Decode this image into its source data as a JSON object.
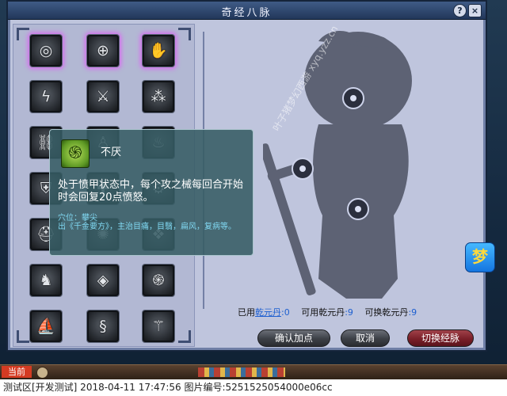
{
  "window": {
    "title": "奇经八脉",
    "help_label": "?",
    "close_label": "×"
  },
  "skills": [
    {
      "icon": "eye-rune-icon",
      "glyph": "◎",
      "active": true
    },
    {
      "icon": "magnifier-rune-icon",
      "glyph": "⊕",
      "active": true
    },
    {
      "icon": "palm-rune-icon",
      "glyph": "✋",
      "active": true
    },
    {
      "icon": "lightning-rune-icon",
      "glyph": "ϟ"
    },
    {
      "icon": "swords-rune-icon",
      "glyph": "⚔"
    },
    {
      "icon": "orbs-rune-icon",
      "glyph": "⁂"
    },
    {
      "icon": "chain-rune-icon",
      "glyph": "⛓"
    },
    {
      "icon": "figure-rune-icon",
      "glyph": "♙"
    },
    {
      "icon": "flame-rune-icon",
      "glyph": "♨"
    },
    {
      "icon": "shield-rune-icon",
      "glyph": "⛨"
    },
    {
      "icon": "cross-rune-icon",
      "glyph": "✚"
    },
    {
      "icon": "gear-rune-icon",
      "glyph": "⚙"
    },
    {
      "icon": "helmet-rune-icon",
      "glyph": "⛑"
    },
    {
      "icon": "spiral-rune-icon",
      "glyph": "✺"
    },
    {
      "icon": "shield-mark-rune-icon",
      "glyph": "❖"
    },
    {
      "icon": "warrior-rune-icon",
      "glyph": "♞"
    },
    {
      "icon": "gem-rune-icon",
      "glyph": "◈"
    },
    {
      "icon": "vortex-rune-icon",
      "glyph": "֍"
    },
    {
      "icon": "ship-rune-icon",
      "glyph": "⛵"
    },
    {
      "icon": "dragon-rune-icon",
      "glyph": "§"
    },
    {
      "icon": "blades-rune-icon",
      "glyph": "⚚"
    }
  ],
  "tooltip": {
    "icon": "vortex-green-icon",
    "glyph": "֍",
    "name": "不厌",
    "description": "处于愤甲状态中，每个攻之械每回合开始时会回复20点愤怒。",
    "acupoint": "穴位：攀尖",
    "source": "出《千金要方》，主治目痛，目翳，扁风，复病等。"
  },
  "watermark": "叶子猪梦幻西游 xyq.yzz.cn",
  "stats": {
    "used_label": "已用",
    "used_link": "乾元丹",
    "used_value": ":0",
    "available_label": "可用乾元丹",
    "available_value": ":9",
    "exchangeable_label": "可换乾元丹",
    "exchangeable_value": ":9"
  },
  "buttons": {
    "confirm": "确认加点",
    "cancel": "取消",
    "switch": "切换经脉"
  },
  "logo": {
    "glyph": "梦"
  },
  "taskbar": {
    "current_tab": "当前"
  },
  "footer": "测试区[开发测试] 2018-04-11 17:47:56 图片编号:5251525054000e06cc"
}
